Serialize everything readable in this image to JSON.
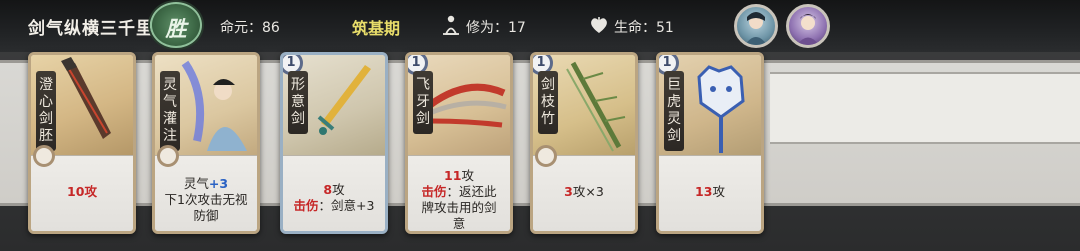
{
  "header": {
    "title": "剑气纵横三千里",
    "result_badge": "胜",
    "mingyuan_label": "命元：86",
    "realm": "筑基期",
    "xiuwei_label": "修为：17",
    "life_label": "生命：51",
    "icons": [
      "meditation-icon",
      "heart-icon"
    ]
  },
  "colors": {
    "accent_green": "#3f6b48",
    "realm_yellow": "#e8dd6a",
    "damage_red": "#c62727",
    "buff_blue": "#2a62c4"
  },
  "cards": [
    {
      "name": [
        "澄",
        "心",
        "剑",
        "胚"
      ],
      "level": "",
      "desc_attack": "10攻"
    },
    {
      "name": [
        "灵",
        "气",
        "灌",
        "注"
      ],
      "level": "",
      "desc_line1_prefix": "灵气",
      "desc_line1_value": "+3",
      "desc_line2": "下1次攻击无视",
      "desc_line3": "防御"
    },
    {
      "name": [
        "形",
        "意",
        "剑"
      ],
      "level": "1",
      "desc_attack_value": "8",
      "desc_attack_unit": "攻",
      "desc_keyword": "击伤",
      "desc_effect": "：剑意+3"
    },
    {
      "name": [
        "飞",
        "牙",
        "剑"
      ],
      "level": "1",
      "desc_attack_value": "11",
      "desc_attack_unit": "攻",
      "desc_keyword": "击伤",
      "desc_effect": "：返还此",
      "desc_line3": "牌攻击用的剑",
      "desc_line4": "意"
    },
    {
      "name": [
        "剑",
        "枝",
        "竹"
      ],
      "level": "1",
      "desc_attack_value": "3",
      "desc_attack_unit": "攻×3"
    },
    {
      "name": [
        "巨",
        "虎",
        "灵",
        "剑"
      ],
      "level": "1",
      "desc_attack_value": "13",
      "desc_attack_unit": "攻"
    }
  ]
}
